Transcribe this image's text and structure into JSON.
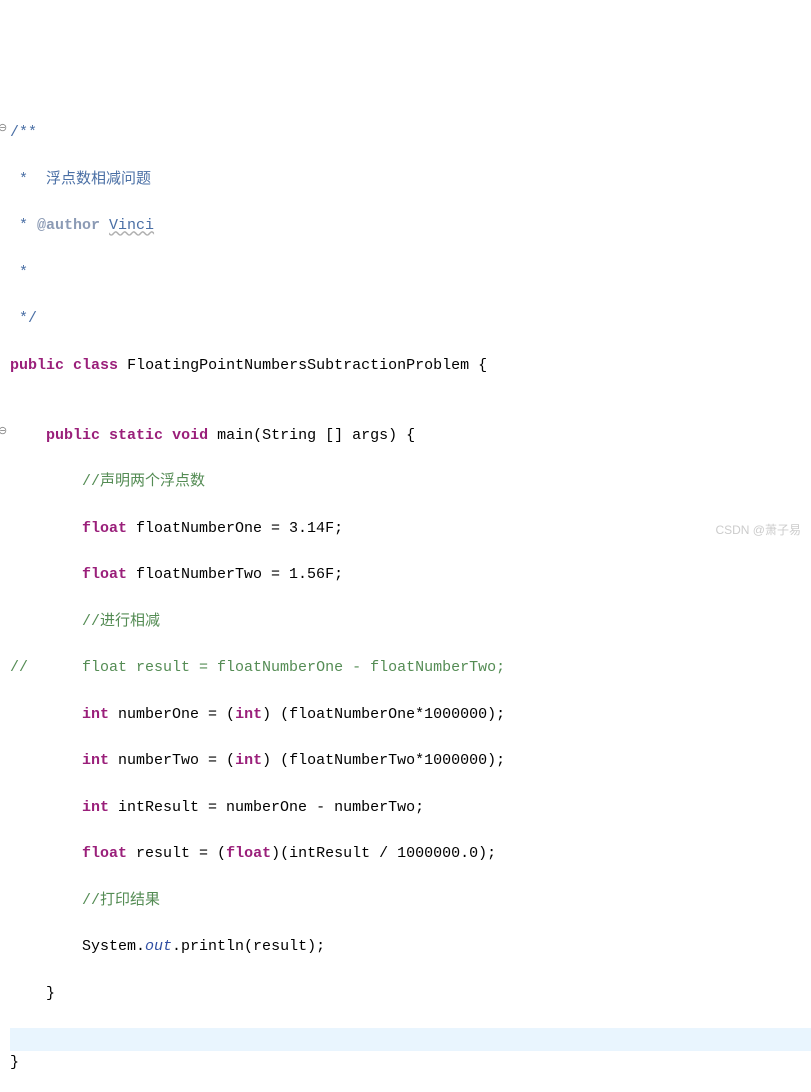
{
  "code": {
    "javadoc_open": "/**",
    "javadoc_line1_prefix": " *  ",
    "javadoc_line1_text": "浮点数相减问题",
    "javadoc_line2_prefix": " * ",
    "javadoc_tag": "@author",
    "javadoc_author": "Vinci",
    "javadoc_empty": " *",
    "javadoc_close": " */",
    "class_decl_kw1": "public",
    "class_decl_kw2": "class",
    "class_name": "FloatingPointNumbersSubtractionProblem",
    "class_brace_open": " {",
    "blank": "",
    "main_indent": "    ",
    "main_kw1": "public",
    "main_kw2": "static",
    "main_kw3": "void",
    "main_name": " main(String [] args) {",
    "body_indent": "        ",
    "comment1": "//声明两个浮点数",
    "kw_float": "float",
    "decl1_rest": " floatNumberOne = 3.14F;",
    "decl2_rest": " floatNumberTwo = 1.56F;",
    "comment2": "//进行相减",
    "commented_prefix": "//",
    "commented_code": "      float result = floatNumberOne - floatNumberTwo;",
    "kw_int": "int",
    "decl3_rest": " numberOne = (",
    "kw_int2": "int",
    "decl3_tail": ") (floatNumberOne*1000000);",
    "decl4_rest": " numberTwo = (",
    "decl4_tail": ") (floatNumberTwo*1000000);",
    "decl5_rest": " intResult = numberOne - numberTwo;",
    "decl6_rest": " result = (",
    "kw_float2": "float",
    "decl6_tail": ")(intResult / 1000000.0);",
    "comment3": "//打印结果",
    "print_obj": "System.",
    "print_out": "out",
    "print_tail": ".println(result);",
    "method_close": "    }",
    "class_close": "}",
    "watermark": "CSDN @萧子易"
  }
}
